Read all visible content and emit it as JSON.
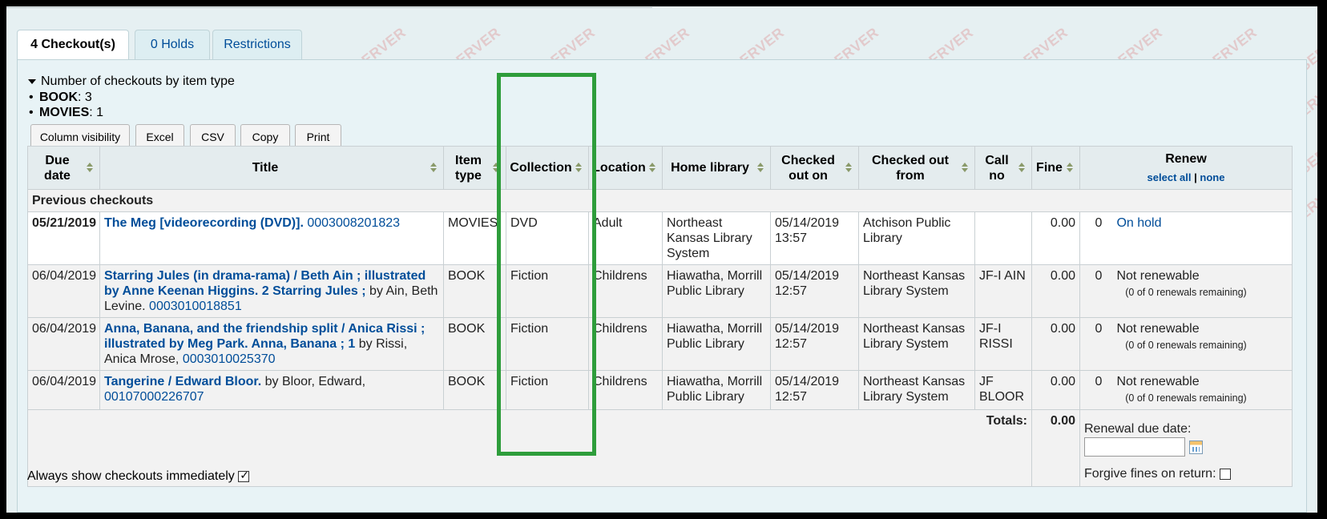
{
  "tabs": [
    {
      "label": "4 Checkout(s)"
    },
    {
      "label": "0 Holds"
    },
    {
      "label": "Restrictions"
    }
  ],
  "summary": {
    "toggle_label": "Number of checkouts by item type",
    "items": [
      {
        "type": "BOOK",
        "count": "3"
      },
      {
        "type": "MOVIES",
        "count": "1"
      }
    ]
  },
  "buttons": {
    "column_visibility": "Column visibility",
    "excel": "Excel",
    "csv": "CSV",
    "copy": "Copy",
    "print": "Print"
  },
  "watermark_text": "TEST SERVER",
  "table": {
    "headers": {
      "due_date": "Due date",
      "title": "Title",
      "item_type": "Item type",
      "collection": "Collection",
      "location": "Location",
      "home_library": "Home library",
      "checked_out_on": "Checked out on",
      "checked_out_from": "Checked out from",
      "call_no": "Call no",
      "fine": "Fine",
      "renew": "Renew",
      "select_all": "select all",
      "separator": "|",
      "none": "none"
    },
    "group_label": "Previous checkouts",
    "rows": [
      {
        "due_date": "05/21/2019",
        "title": "The Meg [videorecording (DVD)].",
        "author": "",
        "barcode": "0003008201823",
        "item_type": "MOVIES",
        "collection": "DVD",
        "location": "Adult",
        "home_library": "Northeast Kansas Library System",
        "checked_out_on": "05/14/2019 13:57",
        "checked_out_from": "Atchison Public Library",
        "call_no": "",
        "fine": "0.00",
        "renew_count": "0",
        "renew_status": "On hold",
        "renew_note": ""
      },
      {
        "due_date": "06/04/2019",
        "title": "Starring Jules (in drama-rama) / Beth Ain ; illustrated by Anne Keenan Higgins. 2 Starring Jules ;",
        "author": "by Ain, Beth Levine.",
        "barcode": "0003010018851",
        "item_type": "BOOK",
        "collection": "Fiction",
        "location": "Childrens",
        "home_library": "Hiawatha, Morrill Public Library",
        "checked_out_on": "05/14/2019 12:57",
        "checked_out_from": "Northeast Kansas Library System",
        "call_no": "JF-I AIN",
        "fine": "0.00",
        "renew_count": "0",
        "renew_status": "Not renewable",
        "renew_note": "(0 of 0 renewals remaining)"
      },
      {
        "due_date": "06/04/2019",
        "title": "Anna, Banana, and the friendship split / Anica Rissi ; illustrated by Meg Park. Anna, Banana ; 1",
        "author": "by Rissi, Anica Mrose,",
        "barcode": "0003010025370",
        "item_type": "BOOK",
        "collection": "Fiction",
        "location": "Childrens",
        "home_library": "Hiawatha, Morrill Public Library",
        "checked_out_on": "05/14/2019 12:57",
        "checked_out_from": "Northeast Kansas Library System",
        "call_no": "JF-I RISSI",
        "fine": "0.00",
        "renew_count": "0",
        "renew_status": "Not renewable",
        "renew_note": "(0 of 0 renewals remaining)"
      },
      {
        "due_date": "06/04/2019",
        "title": "Tangerine / Edward Bloor.",
        "author": "by Bloor, Edward,",
        "barcode": "00107000226707",
        "item_type": "BOOK",
        "collection": "Fiction",
        "location": "Childrens",
        "home_library": "Hiawatha, Morrill Public Library",
        "checked_out_on": "05/14/2019 12:57",
        "checked_out_from": "Northeast Kansas Library System",
        "call_no": "JF BLOOR",
        "fine": "0.00",
        "renew_count": "0",
        "renew_status": "Not renewable",
        "renew_note": "(0 of 0 renewals remaining)"
      }
    ],
    "totals_label": "Totals:",
    "totals_value": "0.00",
    "renewal_due_date_label": "Renewal due date:",
    "forgive_fines_label": "Forgive fines on return:"
  },
  "always_show_label": "Always show checkouts immediately",
  "colors": {
    "link": "#004d99",
    "overdue": "#990000",
    "highlight": "#2e9d3b"
  }
}
